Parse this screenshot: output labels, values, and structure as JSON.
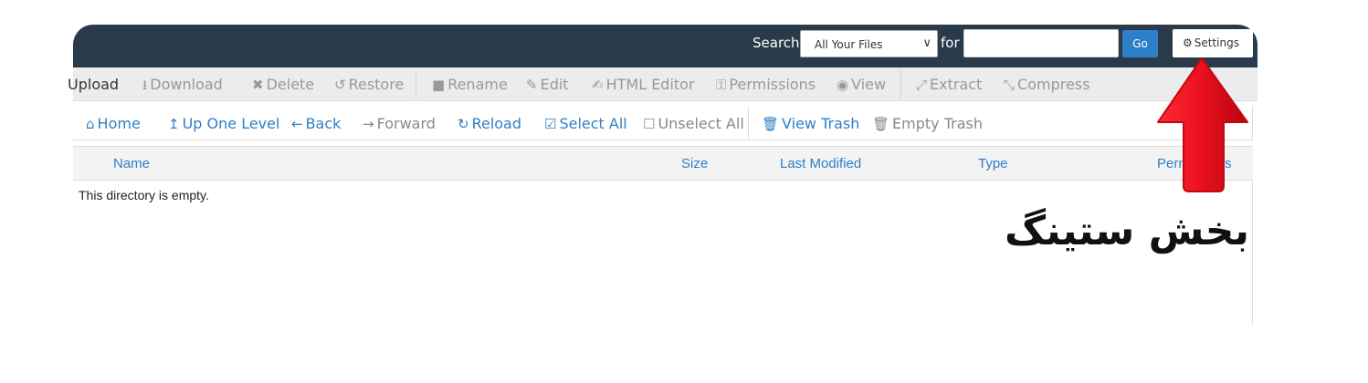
{
  "header": {
    "search_label": "Search",
    "search_scope": "All Your Files",
    "for_label": "for",
    "search_value": "",
    "go_label": "Go",
    "settings_label": "Settings",
    "bar_color": "#293a4a",
    "accent_color": "#2d7fc7"
  },
  "toolbar_actions": [
    {
      "label": "Upload",
      "icon": "upload-icon"
    },
    {
      "label": "Download",
      "icon": "download-icon"
    },
    {
      "label": "Delete",
      "icon": "close-icon"
    },
    {
      "label": "Restore",
      "icon": "undo-icon"
    },
    {
      "label": "Rename",
      "icon": "file-icon"
    },
    {
      "label": "Edit",
      "icon": "pencil-icon"
    },
    {
      "label": "HTML Editor",
      "icon": "edit-square-icon"
    },
    {
      "label": "Permissions",
      "icon": "key-icon"
    },
    {
      "label": "View",
      "icon": "eye-icon"
    },
    {
      "label": "Extract",
      "icon": "expand-icon"
    },
    {
      "label": "Compress",
      "icon": "compress-icon"
    }
  ],
  "nav_actions": [
    {
      "label": "Home",
      "icon": "home-icon"
    },
    {
      "label": "Up One Level",
      "icon": "level-up-icon"
    },
    {
      "label": "Back",
      "icon": "arrow-left-icon"
    },
    {
      "label": "Forward",
      "icon": "arrow-right-icon"
    },
    {
      "label": "Reload",
      "icon": "refresh-icon"
    },
    {
      "label": "Select All",
      "icon": "checkbox-checked-icon"
    },
    {
      "label": "Unselect All",
      "icon": "checkbox-empty-icon"
    },
    {
      "label": "View Trash",
      "icon": "trash-icon"
    },
    {
      "label": "Empty Trash",
      "icon": "trash-icon"
    }
  ],
  "table": {
    "columns": [
      "Name",
      "Size",
      "Last Modified",
      "Type",
      "Permissions"
    ],
    "empty_message": "This directory is empty."
  },
  "annotation": {
    "text": "بخش ستینگ",
    "arrow_color": "#e8101c"
  }
}
